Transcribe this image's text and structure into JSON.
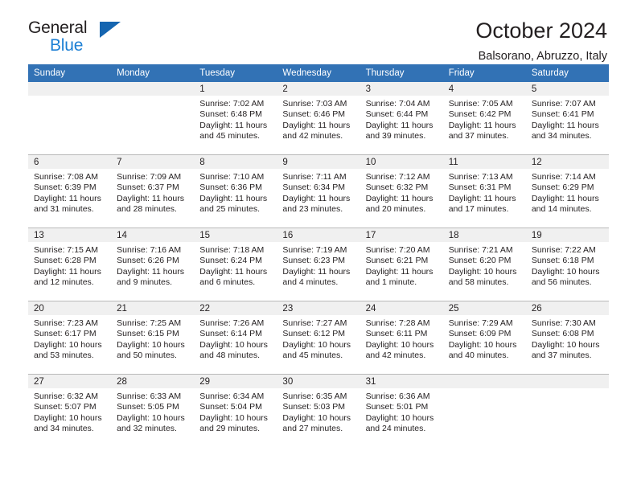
{
  "brand": {
    "name_top": "General",
    "name_bottom": "Blue",
    "accent_color": "#1c7fd4",
    "triangle_color": "#1565b0"
  },
  "header": {
    "title": "October 2024",
    "subtitle": "Balsorano, Abruzzo, Italy",
    "header_bg_color": "#3272b5",
    "daynum_bg_color": "#f0f0f0"
  },
  "weekday_headers": [
    "Sunday",
    "Monday",
    "Tuesday",
    "Wednesday",
    "Thursday",
    "Friday",
    "Saturday"
  ],
  "labels": {
    "sunrise": "Sunrise:",
    "sunset": "Sunset:",
    "daylight": "Daylight:"
  },
  "weeks": [
    [
      {
        "day": "",
        "sunrise": "",
        "sunset": "",
        "daylight": ""
      },
      {
        "day": "",
        "sunrise": "",
        "sunset": "",
        "daylight": ""
      },
      {
        "day": "1",
        "sunrise": "Sunrise: 7:02 AM",
        "sunset": "Sunset: 6:48 PM",
        "daylight": "Daylight: 11 hours and 45 minutes."
      },
      {
        "day": "2",
        "sunrise": "Sunrise: 7:03 AM",
        "sunset": "Sunset: 6:46 PM",
        "daylight": "Daylight: 11 hours and 42 minutes."
      },
      {
        "day": "3",
        "sunrise": "Sunrise: 7:04 AM",
        "sunset": "Sunset: 6:44 PM",
        "daylight": "Daylight: 11 hours and 39 minutes."
      },
      {
        "day": "4",
        "sunrise": "Sunrise: 7:05 AM",
        "sunset": "Sunset: 6:42 PM",
        "daylight": "Daylight: 11 hours and 37 minutes."
      },
      {
        "day": "5",
        "sunrise": "Sunrise: 7:07 AM",
        "sunset": "Sunset: 6:41 PM",
        "daylight": "Daylight: 11 hours and 34 minutes."
      }
    ],
    [
      {
        "day": "6",
        "sunrise": "Sunrise: 7:08 AM",
        "sunset": "Sunset: 6:39 PM",
        "daylight": "Daylight: 11 hours and 31 minutes."
      },
      {
        "day": "7",
        "sunrise": "Sunrise: 7:09 AM",
        "sunset": "Sunset: 6:37 PM",
        "daylight": "Daylight: 11 hours and 28 minutes."
      },
      {
        "day": "8",
        "sunrise": "Sunrise: 7:10 AM",
        "sunset": "Sunset: 6:36 PM",
        "daylight": "Daylight: 11 hours and 25 minutes."
      },
      {
        "day": "9",
        "sunrise": "Sunrise: 7:11 AM",
        "sunset": "Sunset: 6:34 PM",
        "daylight": "Daylight: 11 hours and 23 minutes."
      },
      {
        "day": "10",
        "sunrise": "Sunrise: 7:12 AM",
        "sunset": "Sunset: 6:32 PM",
        "daylight": "Daylight: 11 hours and 20 minutes."
      },
      {
        "day": "11",
        "sunrise": "Sunrise: 7:13 AM",
        "sunset": "Sunset: 6:31 PM",
        "daylight": "Daylight: 11 hours and 17 minutes."
      },
      {
        "day": "12",
        "sunrise": "Sunrise: 7:14 AM",
        "sunset": "Sunset: 6:29 PM",
        "daylight": "Daylight: 11 hours and 14 minutes."
      }
    ],
    [
      {
        "day": "13",
        "sunrise": "Sunrise: 7:15 AM",
        "sunset": "Sunset: 6:28 PM",
        "daylight": "Daylight: 11 hours and 12 minutes."
      },
      {
        "day": "14",
        "sunrise": "Sunrise: 7:16 AM",
        "sunset": "Sunset: 6:26 PM",
        "daylight": "Daylight: 11 hours and 9 minutes."
      },
      {
        "day": "15",
        "sunrise": "Sunrise: 7:18 AM",
        "sunset": "Sunset: 6:24 PM",
        "daylight": "Daylight: 11 hours and 6 minutes."
      },
      {
        "day": "16",
        "sunrise": "Sunrise: 7:19 AM",
        "sunset": "Sunset: 6:23 PM",
        "daylight": "Daylight: 11 hours and 4 minutes."
      },
      {
        "day": "17",
        "sunrise": "Sunrise: 7:20 AM",
        "sunset": "Sunset: 6:21 PM",
        "daylight": "Daylight: 11 hours and 1 minute."
      },
      {
        "day": "18",
        "sunrise": "Sunrise: 7:21 AM",
        "sunset": "Sunset: 6:20 PM",
        "daylight": "Daylight: 10 hours and 58 minutes."
      },
      {
        "day": "19",
        "sunrise": "Sunrise: 7:22 AM",
        "sunset": "Sunset: 6:18 PM",
        "daylight": "Daylight: 10 hours and 56 minutes."
      }
    ],
    [
      {
        "day": "20",
        "sunrise": "Sunrise: 7:23 AM",
        "sunset": "Sunset: 6:17 PM",
        "daylight": "Daylight: 10 hours and 53 minutes."
      },
      {
        "day": "21",
        "sunrise": "Sunrise: 7:25 AM",
        "sunset": "Sunset: 6:15 PM",
        "daylight": "Daylight: 10 hours and 50 minutes."
      },
      {
        "day": "22",
        "sunrise": "Sunrise: 7:26 AM",
        "sunset": "Sunset: 6:14 PM",
        "daylight": "Daylight: 10 hours and 48 minutes."
      },
      {
        "day": "23",
        "sunrise": "Sunrise: 7:27 AM",
        "sunset": "Sunset: 6:12 PM",
        "daylight": "Daylight: 10 hours and 45 minutes."
      },
      {
        "day": "24",
        "sunrise": "Sunrise: 7:28 AM",
        "sunset": "Sunset: 6:11 PM",
        "daylight": "Daylight: 10 hours and 42 minutes."
      },
      {
        "day": "25",
        "sunrise": "Sunrise: 7:29 AM",
        "sunset": "Sunset: 6:09 PM",
        "daylight": "Daylight: 10 hours and 40 minutes."
      },
      {
        "day": "26",
        "sunrise": "Sunrise: 7:30 AM",
        "sunset": "Sunset: 6:08 PM",
        "daylight": "Daylight: 10 hours and 37 minutes."
      }
    ],
    [
      {
        "day": "27",
        "sunrise": "Sunrise: 6:32 AM",
        "sunset": "Sunset: 5:07 PM",
        "daylight": "Daylight: 10 hours and 34 minutes."
      },
      {
        "day": "28",
        "sunrise": "Sunrise: 6:33 AM",
        "sunset": "Sunset: 5:05 PM",
        "daylight": "Daylight: 10 hours and 32 minutes."
      },
      {
        "day": "29",
        "sunrise": "Sunrise: 6:34 AM",
        "sunset": "Sunset: 5:04 PM",
        "daylight": "Daylight: 10 hours and 29 minutes."
      },
      {
        "day": "30",
        "sunrise": "Sunrise: 6:35 AM",
        "sunset": "Sunset: 5:03 PM",
        "daylight": "Daylight: 10 hours and 27 minutes."
      },
      {
        "day": "31",
        "sunrise": "Sunrise: 6:36 AM",
        "sunset": "Sunset: 5:01 PM",
        "daylight": "Daylight: 10 hours and 24 minutes."
      },
      {
        "day": "",
        "sunrise": "",
        "sunset": "",
        "daylight": ""
      },
      {
        "day": "",
        "sunrise": "",
        "sunset": "",
        "daylight": ""
      }
    ]
  ]
}
